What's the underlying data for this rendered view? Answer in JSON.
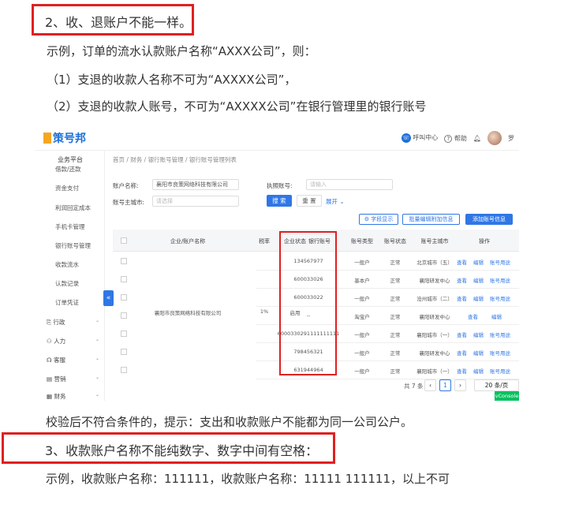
{
  "doc": {
    "heading2": "2、收、退账户不能一样。",
    "example_intro": "示例，订单的流水认款账户名称“AXXX公司”，则：",
    "rule1": "（1）支退的收款人名称不可为“AXXXX公司”，",
    "rule2": "（2）支退的收款人账号，不可为“AXXXX公司”在银行管理里的银行账号",
    "validation": "校验后不符合条件的，提示：支出和收款账户不能都为同一公司公户。",
    "heading3": "3、收款账户名称不能纯数字、数字中间有空格：",
    "example3": "示例，收款账户名称：111111，收款账户名称：11111   111111，以上不可"
  },
  "app": {
    "logo": "策号邦",
    "top": {
      "call_center": "呼叫中心",
      "help": "帮助",
      "user": "罗"
    },
    "sidebar": {
      "title": "业务平台",
      "items": [
        "借款/还款",
        "资金支付",
        "利润回定成本",
        "手机卡管理",
        "银行账号管理",
        "收款流水",
        "认款记录",
        "订单凭证"
      ],
      "groups": [
        "行政",
        "人力",
        "客服",
        "营销",
        "财务"
      ]
    },
    "breadcrumb": "首页 / 财务 / 银行账号管理 / 银行账号管理列表",
    "form": {
      "company_label": "账户名称:",
      "company_value": "襄阳市良策网络科技有限公司",
      "license_label": "执照账号:",
      "license_placeholder": "请输入",
      "city_label": "账号主城市:",
      "city_placeholder": "请选择",
      "search": "搜 索",
      "reset": "重 置",
      "expand": "展开"
    },
    "actions": {
      "field_display": "字段显示",
      "batch_edit": "批量编辑附加信息",
      "add_account": "添加账号信息"
    },
    "table": {
      "headers": [
        "企业/账户名称",
        "税率",
        "企业状态",
        "银行账号",
        "账号类型",
        "账号状态",
        "账号主城市",
        "操作"
      ],
      "company": "襄阳市良策网络科技有限公司",
      "tax": "1%",
      "company_status": "启用",
      "rows": [
        {
          "account": "134567977",
          "type": "一般户",
          "status": "正常",
          "city": "北京城市（五）",
          "ops": [
            "查看",
            "编辑",
            "账号用途"
          ]
        },
        {
          "account": "600033026",
          "type": "基本户",
          "status": "正常",
          "city": "襄阳研发中心",
          "ops": [
            "查看",
            "编辑",
            "账号用途"
          ]
        },
        {
          "account": "600033022",
          "type": "一般户",
          "status": "正常",
          "city": "沧州城市（二）",
          "ops": [
            "查看",
            "编辑",
            "账号用途"
          ]
        },
        {
          "account": "--",
          "type": "淘宝户",
          "status": "正常",
          "city": "襄阳研发中心",
          "ops": [
            "查看",
            "编辑"
          ]
        },
        {
          "account": "6000330291111111111",
          "type": "一般户",
          "status": "正常",
          "city": "襄阳城市（一）",
          "ops": [
            "查看",
            "编辑",
            "账号用途"
          ]
        },
        {
          "account": "798456321",
          "type": "一般户",
          "status": "正常",
          "city": "襄阳研发中心",
          "ops": [
            "查看",
            "编辑",
            "账号用途"
          ]
        },
        {
          "account": "631944964",
          "type": "一般户",
          "status": "正常",
          "city": "襄阳城市（一）",
          "ops": [
            "查看",
            "编辑",
            "账号用途"
          ]
        }
      ]
    },
    "pager": {
      "total": "共 7 条",
      "page": "1",
      "size": "20 条/页"
    },
    "vconsole": "vConsole"
  }
}
